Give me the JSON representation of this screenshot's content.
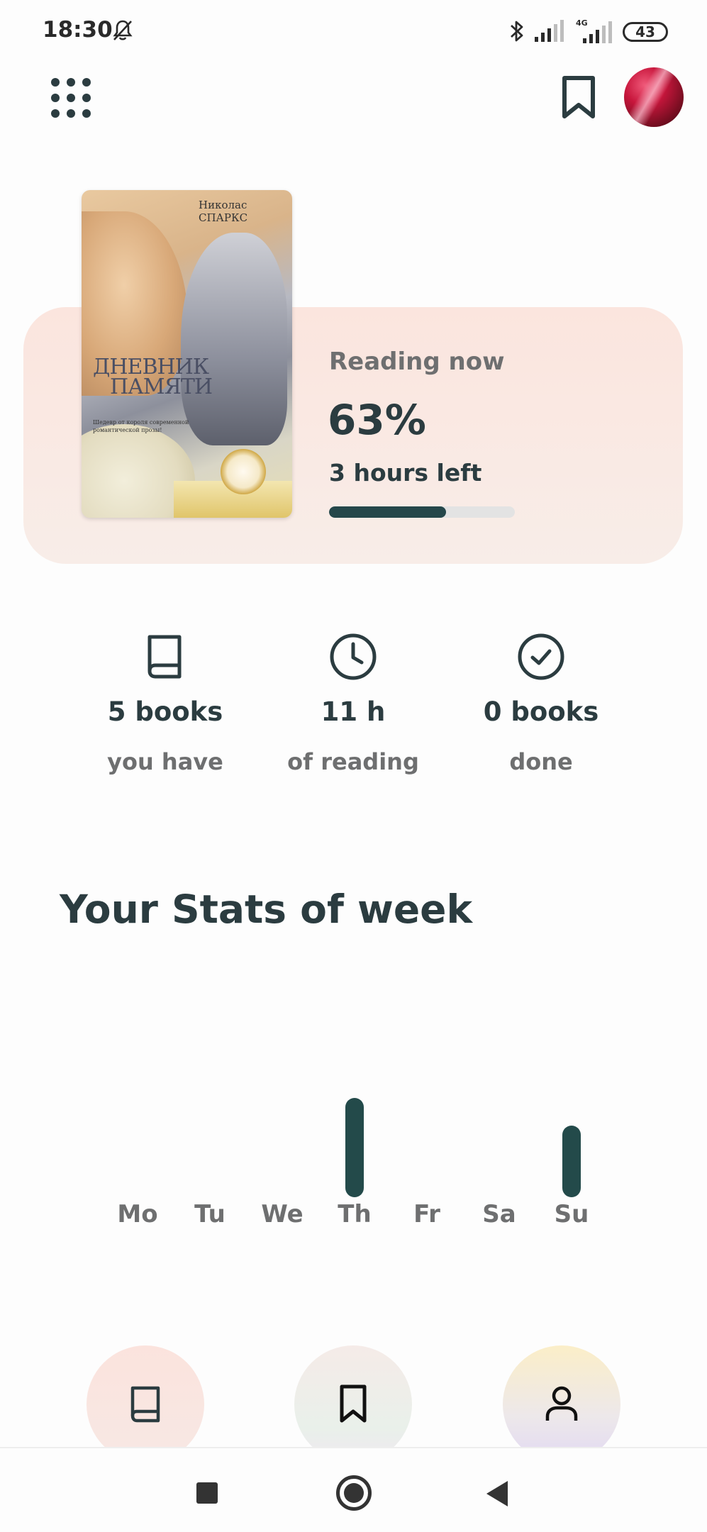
{
  "status_bar": {
    "time": "18:30",
    "network": "4G",
    "battery": "43",
    "icons": [
      "mute-icon",
      "bluetooth-icon",
      "signal-icon",
      "signal-4g-icon",
      "battery-icon"
    ]
  },
  "top_bar": {
    "icons": [
      "grid-menu-icon",
      "bookmark-icon",
      "avatar"
    ]
  },
  "reading_now": {
    "cover": {
      "author": "Николас СПАРКС",
      "title_line1": "ДНЕВНИК",
      "title_line2": "ПАМЯТИ",
      "tagline": "Шедевр от короля современной романтической прозы!"
    },
    "label": "Reading now",
    "percent": "63%",
    "progress": 0.63,
    "time_left": "3 hours left"
  },
  "stats": [
    {
      "icon": "book-icon",
      "value": "5 books",
      "label": "you have"
    },
    {
      "icon": "clock-icon",
      "value": "11 h",
      "label": "of reading"
    },
    {
      "icon": "check-circle-icon",
      "value": "0 books",
      "label": "done"
    }
  ],
  "week": {
    "title": "Your Stats of week"
  },
  "chart_data": {
    "type": "bar",
    "title": "Your Stats of week",
    "categories": [
      "Mo",
      "Tu",
      "We",
      "Th",
      "Fr",
      "Sa",
      "Su"
    ],
    "values": [
      0,
      0,
      0,
      100,
      0,
      0,
      72
    ],
    "xlabel": "",
    "ylabel": "",
    "grid": false
  },
  "bottom_nav": {
    "items": [
      {
        "icon": "book-icon",
        "name": "library"
      },
      {
        "icon": "bookmark-icon",
        "name": "bookmarks"
      },
      {
        "icon": "user-icon",
        "name": "profile"
      }
    ]
  },
  "colors": {
    "accent": "#234a4a",
    "text_dark": "#2b3c40",
    "text_muted": "#6e6f70",
    "card_bg": "#fbe5de"
  }
}
